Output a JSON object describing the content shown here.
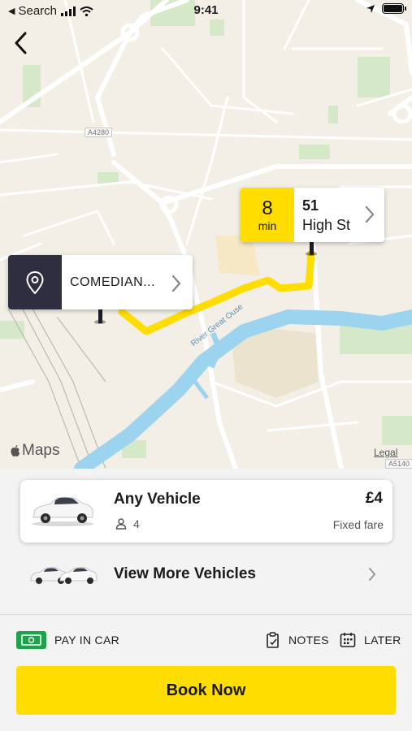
{
  "status_bar": {
    "back_app": "Search",
    "time": "9:41"
  },
  "map": {
    "road_label_a": "A4280",
    "road_label_b": "A5140",
    "river_label": "River Great Ouse",
    "maps_brand": "Maps",
    "legal": "Legal",
    "route_color": "#FFDD00",
    "water_color": "#9CD3EE"
  },
  "eta_marker": {
    "minutes": "8",
    "unit": "min",
    "address_number": "51",
    "address_street": "High St"
  },
  "pickup_marker": {
    "name": "COMEDIAN..."
  },
  "vehicle": {
    "title": "Any Vehicle",
    "seats": "4",
    "price": "£4",
    "fare_type": "Fixed fare"
  },
  "more_vehicles": {
    "label": "View More Vehicles"
  },
  "options": {
    "payment": "PAY IN CAR",
    "notes": "NOTES",
    "later": "LATER"
  },
  "actions": {
    "book": "Book Now"
  },
  "colors": {
    "accent": "#FFDD00",
    "dark": "#2F2D40",
    "pay_green": "#1EA24A"
  }
}
